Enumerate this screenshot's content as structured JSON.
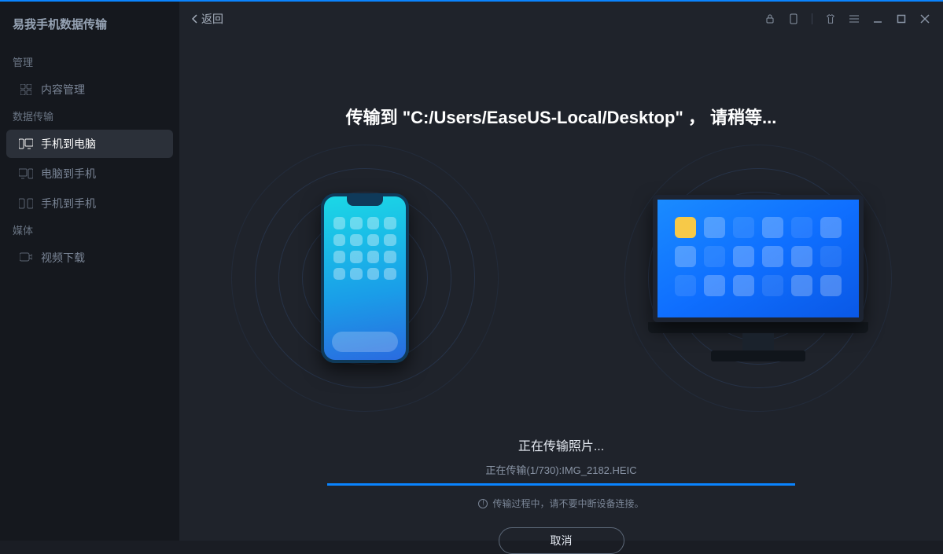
{
  "app_title": "易我手机数据传输",
  "sidebar": {
    "section_manage": "管理",
    "item_content_manage": "内容管理",
    "section_transfer": "数据传输",
    "item_phone_to_pc": "手机到电脑",
    "item_pc_to_phone": "电脑到手机",
    "item_phone_to_phone": "手机到手机",
    "section_media": "媒体",
    "item_video_download": "视频下载"
  },
  "topbar": {
    "back": "返回"
  },
  "transfer": {
    "heading": "传输到 \"C:/Users/EaseUS-Local/Desktop\" ， 请稍等...",
    "status_title": "正在传输照片...",
    "status_file": "正在传输(1/730):IMG_2182.HEIC",
    "progress_percent": 100,
    "warning": "传输过程中，请不要中断设备连接。",
    "cancel": "取消"
  }
}
